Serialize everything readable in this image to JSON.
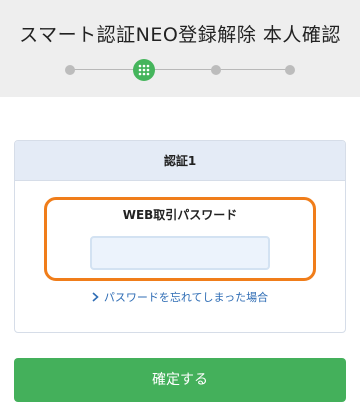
{
  "header": {
    "title": "スマート認証NEO登録解除 本人確認",
    "steps": [
      {
        "state": "done"
      },
      {
        "state": "current",
        "icon": "keypad-icon"
      },
      {
        "state": "pending"
      },
      {
        "state": "pending"
      }
    ]
  },
  "card": {
    "title": "認証1",
    "field_label": "WEB取引パスワード",
    "password_value": "",
    "forgot_link": "パスワードを忘れてしまった場合"
  },
  "actions": {
    "confirm_label": "確定する"
  },
  "colors": {
    "accent_green": "#44b05b",
    "highlight_orange": "#f07d1a",
    "link_blue": "#2f6db5"
  }
}
